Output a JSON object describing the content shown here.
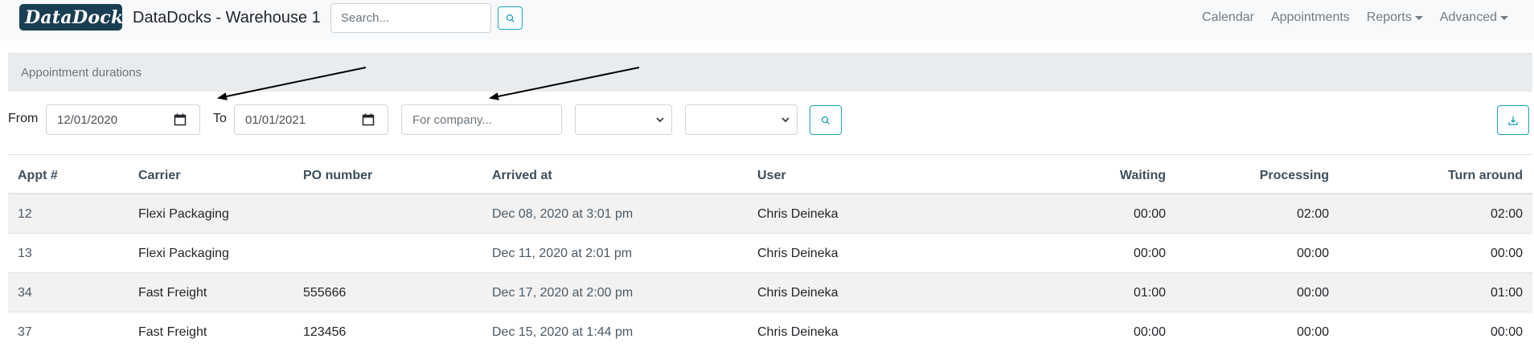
{
  "navbar": {
    "logo_left": "Data",
    "logo_right": "Docks",
    "title": "DataDocks - Warehouse 1",
    "search_placeholder": "Search...",
    "links": {
      "calendar": "Calendar",
      "appointments": "Appointments",
      "reports": "Reports",
      "advanced": "Advanced"
    }
  },
  "report": {
    "title": "Appointment durations"
  },
  "filters": {
    "from_label": "From",
    "from_value": "12/01/2020",
    "to_label": "To",
    "to_value": "01/01/2021",
    "company_placeholder": "For company...",
    "select_1_value": "",
    "select_2_value": ""
  },
  "table": {
    "columns": {
      "appt": "Appt #",
      "carrier": "Carrier",
      "po": "PO number",
      "arrived": "Arrived at",
      "user": "User",
      "waiting": "Waiting",
      "processing": "Processing",
      "turnaround": "Turn around"
    },
    "rows": [
      {
        "appt": "12",
        "carrier": "Flexi Packaging",
        "po": "",
        "arrived": "Dec 08, 2020 at 3:01 pm",
        "user": "Chris Deineka",
        "waiting": "00:00",
        "processing": "02:00",
        "turnaround": "02:00"
      },
      {
        "appt": "13",
        "carrier": "Flexi Packaging",
        "po": "",
        "arrived": "Dec 11, 2020 at 2:01 pm",
        "user": "Chris Deineka",
        "waiting": "00:00",
        "processing": "00:00",
        "turnaround": "00:00"
      },
      {
        "appt": "34",
        "carrier": "Fast Freight",
        "po": "555666",
        "arrived": "Dec 17, 2020 at 2:00 pm",
        "user": "Chris Deineka",
        "waiting": "01:00",
        "processing": "00:00",
        "turnaround": "01:00"
      },
      {
        "appt": "37",
        "carrier": "Fast Freight",
        "po": "123456",
        "arrived": "Dec 15, 2020 at 1:44 pm",
        "user": "Chris Deineka",
        "waiting": "00:00",
        "processing": "00:00",
        "turnaround": "00:00"
      }
    ]
  },
  "colors": {
    "accent": "#17a2b8",
    "brand": "#1a3e52",
    "header_band": "#e9ecef"
  },
  "icons": [
    "search-icon",
    "calendar-icon",
    "chevron-down-icon",
    "download-icon",
    "arrow-annotation"
  ]
}
